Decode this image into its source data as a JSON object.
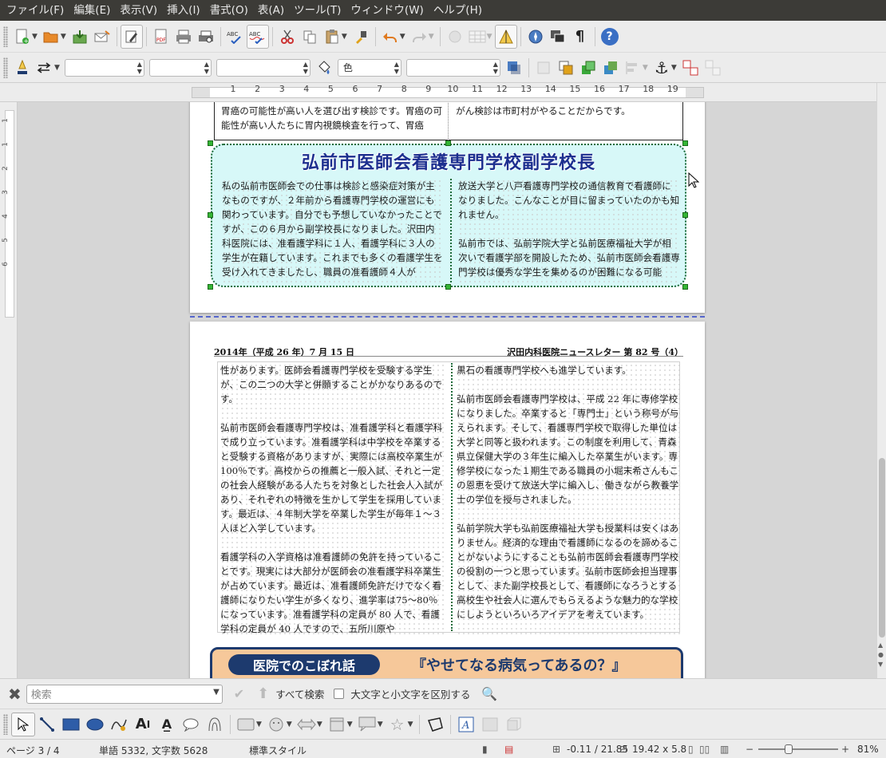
{
  "menu": [
    "ファイル(F)",
    "編集(E)",
    "表示(V)",
    "挿入(I)",
    "書式(O)",
    "表(A)",
    "ツール(T)",
    "ウィンドウ(W)",
    "ヘルプ(H)"
  ],
  "toolbar2": {
    "color_label": "色"
  },
  "ruler": {
    "ticks": [
      "1",
      "2",
      "3",
      "4",
      "5",
      "6",
      "7",
      "8",
      "9",
      "10",
      "11",
      "12",
      "13",
      "14",
      "15",
      "16",
      "17",
      "18",
      "19"
    ],
    "vticks": [
      "1",
      "1",
      "2",
      "3",
      "4",
      "5",
      "6"
    ]
  },
  "page1": {
    "top_col1": "胃癌の可能性が高い人を選び出す検診です。胃癌の可能性が高い人たちに胃内視鏡検査を行って、胃癌",
    "top_col2": "がん検診は市町村がやることだからです。",
    "box_title": "弘前市医師会看護専門学校副学校長",
    "box_col1": "私の弘前市医師会での仕事は検診と感染症対策が主なものですが、２年前から看護専門学校の運営にも関わっています。自分でも予想していなかったことですが、この６月から副学校長になりました。沢田内科医院には、准看護学科に１人、看護学科に３人の学生が在籍しています。これまでも多くの看護学生を受け入れてきましたし、職員の准看護師４人が",
    "box_col2_p1": "放送大学と八戸看護専門学校の通信教育で看護師になりました。こんなことが目に留まっていたのかも知れません。",
    "box_col2_p2": "弘前市では、弘前学院大学と弘前医療福祉大学が相次いで看護学部を開設したため、弘前市医師会看護専門学校は優秀な学生を集めるのが困難になる可能"
  },
  "page2": {
    "header_left": "2014年（平成 26 年）7 月 15 日",
    "header_right": "沢田内科医院ニュースレター 第 82 号（4）",
    "col1_p1": "性があります。医師会看護専門学校を受験する学生が、この二つの大学と併願することがかなりあるのです。",
    "col1_p2": "弘前市医師会看護専門学校は、准看護学科と看護学科で成り立っています。准看護学科は中学校を卒業すると受験する資格がありますが、実際には高校卒業生が100％です。高校からの推薦と一般入試、それと一定の社会人経験がある人たちを対象とした社会人入試があり、それぞれの特徴を生かして学生を採用しています。最近は、４年制大学を卒業した学生が毎年１～３人ほど入学しています。",
    "col1_p3": "看護学科の入学資格は准看護師の免許を持っていることです。現実には大部分が医師会の准看護学科卒業生が占めています。最近は、准看護師免許だけでなく看護師になりたい学生が多くなり、進学率は75～80％になっています。准看護学科の定員が 80 人で、看護学科の定員が 40 人ですので、五所川原や",
    "col2_p1": "黒石の看護専門学校へも進学しています。",
    "col2_p2": "弘前市医師会看護専門学校は、平成 22 年に専修学校になりました。卒業すると「専門士」という称号が与えられます。そして、看護専門学校で取得した単位は大学と同等と扱われます。この制度を利用して、青森県立保健大学の３年生に編入した卒業生がいます。専修学校になった１期生である職員の小堀末希さんもこの恩恵を受けて放送大学に編入し、働きながら教養学士の学位を授与されました。",
    "col2_p3": "弘前学院大学も弘前医療福祉大学も授業料は安くはありません。経済的な理由で看護師になるのを諦めることがないようにすることも弘前市医師会看護専門学校の役割の一つと思っています。弘前市医師会担当理事として、また副学校長として、看護師になろうとする高校生や社会人に選んでもらえるような魅力的な学校にしようといろいろアイデアを考えています。",
    "banner_pill": "医院でのこぼれ話",
    "banner_title": "『やせてなる病気ってあるの？』"
  },
  "findbar": {
    "placeholder": "検索",
    "find_all": "すべて検索",
    "match_case": "大文字と小文字を区別する"
  },
  "status": {
    "page": "ページ 3 / 4",
    "words": "単語 5332, 文字数 5628",
    "style": "標準スタイル",
    "position": "-0.11 / 21.85",
    "size": "19.42 x 5.8",
    "zoom": "81%"
  },
  "colors": {
    "menubar": "#3c3b37",
    "box_fill": "#d7f8f8",
    "box_border": "#1d6b3a",
    "title": "#1c2f8f",
    "banner": "#f6c89a",
    "banner_dark": "#1d3a6e"
  }
}
